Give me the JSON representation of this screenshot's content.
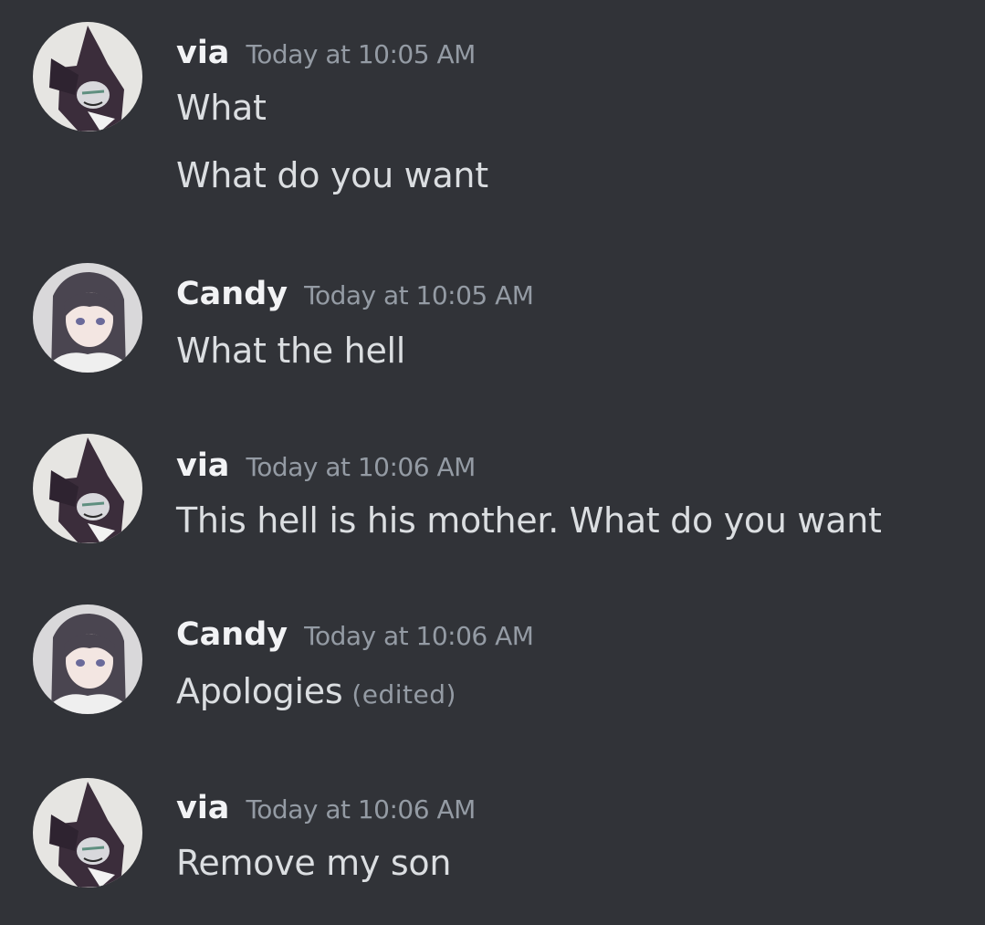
{
  "messages": [
    {
      "author": "via",
      "avatar_icon": "via-avatar-icon",
      "timestamp": "Today at 10:05 AM",
      "lines": [
        "What",
        "What do you want"
      ]
    },
    {
      "author": "Candy",
      "avatar_icon": "candy-avatar-icon",
      "timestamp": "Today at 10:05 AM",
      "lines": [
        "What the hell"
      ]
    },
    {
      "author": "via",
      "avatar_icon": "via-avatar-icon",
      "timestamp": "Today at 10:06 AM",
      "lines": [
        "This hell is his mother.  What do you want"
      ]
    },
    {
      "author": "Candy",
      "avatar_icon": "candy-avatar-icon",
      "timestamp": "Today at 10:06 AM",
      "lines": [
        "Apologies"
      ],
      "edited_label": "(edited)"
    },
    {
      "author": "via",
      "avatar_icon": "via-avatar-icon",
      "timestamp": "Today at 10:06 AM",
      "lines": [
        "Remove my son"
      ]
    }
  ],
  "colors": {
    "background": "#313338",
    "username": "#f2f3f5",
    "timestamp": "#949ba4",
    "message_text": "#dbdee1"
  }
}
